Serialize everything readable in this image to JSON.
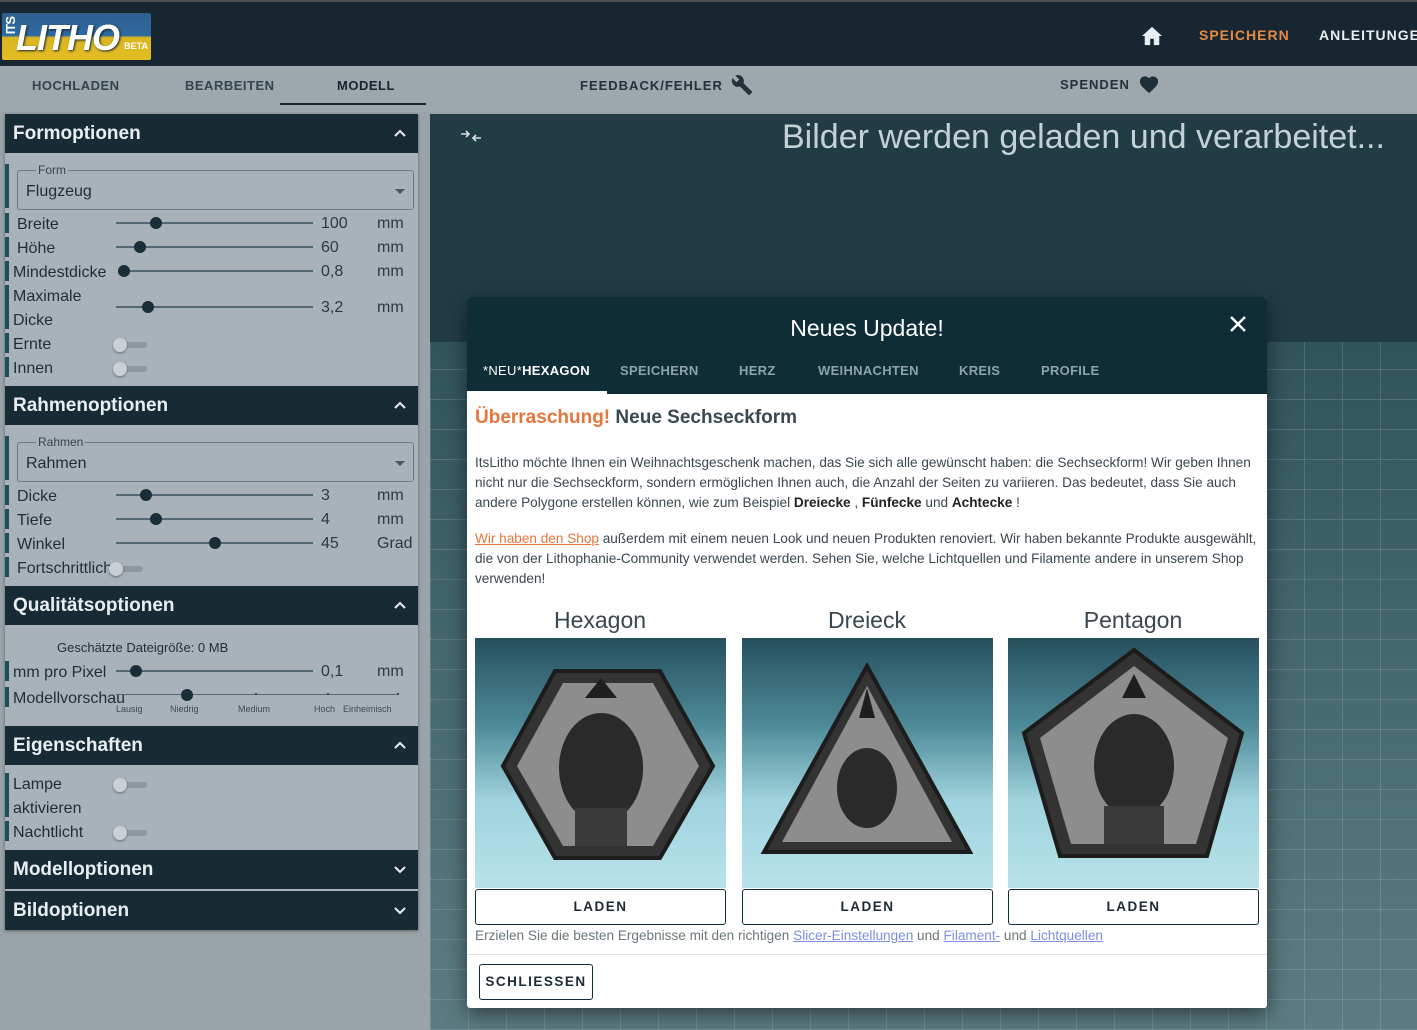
{
  "header": {
    "logo_prefix": "ITS",
    "logo_text": "LITHO",
    "logo_badge": "BETA",
    "nav_save": "SPEICHERN",
    "nav_guides": "ANLEITUNGEN"
  },
  "tabs": {
    "upload": "HOCHLADEN",
    "edit": "BEARBEITEN",
    "model": "MODELL",
    "feedback": "FEEDBACK/FEHLER",
    "donate": "SPENDEN"
  },
  "sidebar": {
    "form": {
      "title": "Formoptionen",
      "select_legend": "Form",
      "select_value": "Flugzeug",
      "width_label": "Breite",
      "width_value": "100",
      "width_unit": "mm",
      "height_label": "Höhe",
      "height_value": "60",
      "height_unit": "mm",
      "min_label": "Mindestdicke",
      "min_value": "0,8",
      "min_unit": "mm",
      "max_label_1": "Maximale",
      "max_label_2": "Dicke",
      "max_value": "3,2",
      "max_unit": "mm",
      "crop_label": "Ernte",
      "inner_label": "Innen"
    },
    "frame": {
      "title": "Rahmenoptionen",
      "select_legend": "Rahmen",
      "select_value": "Rahmen",
      "thick_label": "Dicke",
      "thick_value": "3",
      "thick_unit": "mm",
      "depth_label": "Tiefe",
      "depth_value": "4",
      "depth_unit": "mm",
      "angle_label": "Winkel",
      "angle_value": "45",
      "angle_unit": "Grad",
      "advanced_label": "Fortschrittlich"
    },
    "quality": {
      "title": "Qualitätsoptionen",
      "filesize": "Geschätzte Dateigröße: 0 MB",
      "mm_label": "mm pro Pixel",
      "mm_value": "0,1",
      "mm_unit": "mm",
      "preview_label": "Modellvorschau",
      "ticks": [
        "Lausig",
        "Niedrig",
        "Medium",
        "Hoch",
        "Einheimisch"
      ]
    },
    "props": {
      "title": "Eigenschaften",
      "lamp_label_1": "Lampe",
      "lamp_label_2": "aktivieren",
      "night_label": "Nachtlicht"
    },
    "model_title": "Modelloptionen",
    "image_title": "Bildoptionen"
  },
  "viewport": {
    "loading_text": "Bilder werden geladen und verarbeitet..."
  },
  "modal": {
    "title": "Neues Update!",
    "tabs": {
      "hex_prefix": "*NEU*",
      "hex": "HEXAGON",
      "save": "SPEICHERN",
      "heart": "HERZ",
      "xmas": "WEIHNACHTEN",
      "circle": "KREIS",
      "profile": "PROFILE"
    },
    "subtitle_highlight": "Überraschung!",
    "subtitle_rest": " Neue Sechseckform",
    "p1_text": "ItsLitho möchte Ihnen ein Weihnachtsgeschenk machen, das Sie sich alle gewünscht haben: die Sechseckform! Wir geben Ihnen nicht nur die Sechseckform, sondern ermöglichen Ihnen auch, die Anzahl der Seiten zu variieren. Das bedeutet, dass Sie auch andere Polygone erstellen können, wie zum Beispiel ",
    "p1_b1": "Dreiecke",
    "p1_sep1": " , ",
    "p1_b2": "Fünfecke",
    "p1_sep2": " und ",
    "p1_b3": "Achtecke",
    "p1_end": " !",
    "p2_link": "Wir haben den Shop",
    "p2_text": " außerdem mit einem neuen Look und neuen Produkten renoviert. Wir haben bekannte Produkte ausgewählt, die von der Lithophanie-Community verwendet werden. Sehen Sie, welche Lichtquellen und Filamente andere in unserem Shop verwenden!",
    "cards": [
      {
        "title": "Hexagon",
        "button": "LADEN"
      },
      {
        "title": "Dreieck",
        "button": "LADEN"
      },
      {
        "title": "Pentagon",
        "button": "LADEN"
      }
    ],
    "foot_text_1": "Erzielen Sie die besten Ergebnisse mit den richtigen ",
    "foot_link_1": "Slicer-Einstellungen",
    "foot_text_2": " und ",
    "foot_link_2": "Filament-",
    "foot_text_3": " und ",
    "foot_link_3": "Lichtquellen",
    "close_button": "SCHLIESSEN"
  },
  "colors": {
    "header_bg": "#172631",
    "accent_orange": "#e58a45",
    "panel_header": "#172b35",
    "modal_header": "#0e2d36"
  }
}
